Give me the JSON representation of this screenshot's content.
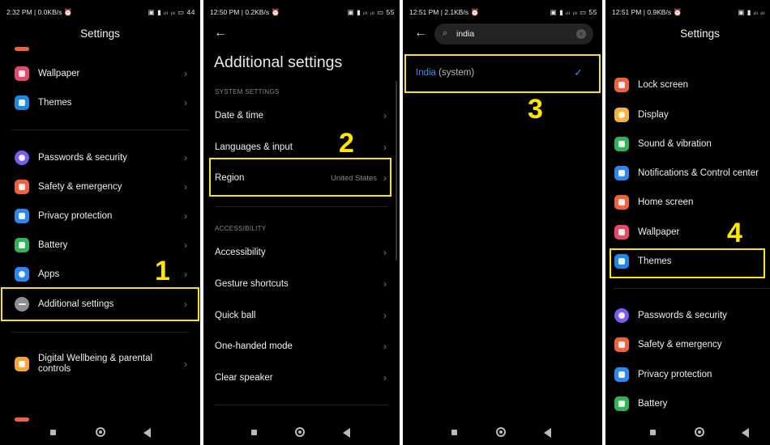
{
  "panel1": {
    "status_time": "2:32 PM | 0.0KB/s ⏰",
    "status_right": "▣ ▮ ᵢₗₗ ᵢₗₗ ▭ 44",
    "title": "Settings",
    "items": [
      {
        "label": "Wallpaper",
        "icon": "wallpaper-icon",
        "color": "#e8486a"
      },
      {
        "label": "Themes",
        "icon": "themes-icon",
        "color": "#1e88e5"
      },
      {
        "label": "Passwords & security",
        "icon": "fingerprint-icon",
        "color": "#7c5cf0"
      },
      {
        "label": "Safety & emergency",
        "icon": "emergency-icon",
        "color": "#f0623d"
      },
      {
        "label": "Privacy protection",
        "icon": "privacy-icon",
        "color": "#2e86f0"
      },
      {
        "label": "Battery",
        "icon": "battery-icon",
        "color": "#2fb457"
      },
      {
        "label": "Apps",
        "icon": "apps-icon",
        "color": "#2e86f0"
      },
      {
        "label": "Additional settings",
        "icon": "more-icon",
        "color": "#8e8e93"
      },
      {
        "label": "Digital Wellbeing & parental controls",
        "icon": "wellbeing-icon",
        "color": "#f4a63b"
      }
    ],
    "step": "1"
  },
  "panel2": {
    "status_time": "12:50 PM | 0.2KB/s ⏰",
    "status_right": "▣ ▮ ᵢₗₗ ᵢₗₗ ▭ 55",
    "title": "Additional settings",
    "section_system": "SYSTEM SETTINGS",
    "section_access": "ACCESSIBILITY",
    "items_system": [
      {
        "label": "Date & time",
        "value": ""
      },
      {
        "label": "Languages & input",
        "value": ""
      },
      {
        "label": "Region",
        "value": "United States"
      }
    ],
    "items_access": [
      {
        "label": "Accessibility"
      },
      {
        "label": "Gesture shortcuts"
      },
      {
        "label": "Quick ball"
      },
      {
        "label": "One-handed mode"
      },
      {
        "label": "Clear speaker"
      }
    ],
    "step": "2"
  },
  "panel3": {
    "status_time": "12:51 PM | 2.1KB/s ⏰",
    "status_right": "▣ ▮ ᵢₗₗ ᵢₗₗ ▭ 55",
    "search_value": "india",
    "result_highlight": "India",
    "result_rest": " (system)",
    "check": "✓",
    "step": "3"
  },
  "panel4": {
    "status_time": "12:51 PM | 0.9KB/s ⏰",
    "status_right": "▣ ▮ ᵢₗₗ ᵢₗₗ",
    "title": "Settings",
    "items": [
      {
        "label": "Lock screen",
        "icon": "lock-icon",
        "color": "#f0623d"
      },
      {
        "label": "Display",
        "icon": "display-icon",
        "color": "#f4b43b"
      },
      {
        "label": "Sound & vibration",
        "icon": "sound-icon",
        "color": "#2fb457"
      },
      {
        "label": "Notifications & Control center",
        "icon": "notifications-icon",
        "color": "#2e86f0"
      },
      {
        "label": "Home screen",
        "icon": "home-icon",
        "color": "#f0623d"
      },
      {
        "label": "Wallpaper",
        "icon": "wallpaper-icon",
        "color": "#e8486a"
      },
      {
        "label": "Themes",
        "icon": "themes-icon",
        "color": "#1e88e5"
      },
      {
        "label": "Passwords & security",
        "icon": "fingerprint-icon",
        "color": "#7c5cf0"
      },
      {
        "label": "Safety & emergency",
        "icon": "emergency-icon",
        "color": "#f0623d"
      },
      {
        "label": "Privacy protection",
        "icon": "privacy-icon",
        "color": "#2e86f0"
      },
      {
        "label": "Battery",
        "icon": "battery-icon",
        "color": "#2fb457"
      }
    ],
    "step": "4"
  },
  "highlight_color": "#ffe600",
  "accent_blue": "#3d8ef8"
}
